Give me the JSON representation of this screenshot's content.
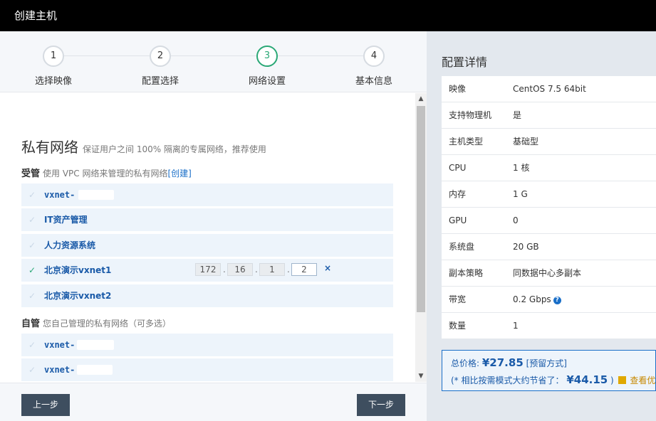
{
  "window": {
    "title": "创建主机"
  },
  "steps": [
    {
      "num": "1",
      "label": "选择映像"
    },
    {
      "num": "2",
      "label": "配置选择"
    },
    {
      "num": "3",
      "label": "网络设置"
    },
    {
      "num": "4",
      "label": "基本信息"
    }
  ],
  "network": {
    "title": "私有网络",
    "subtitle": "保证用户之间 100% 隔离的专属网络，推荐使用",
    "managed": {
      "label": "受管",
      "desc": "使用 VPC 网络来管理的私有网络",
      "create_link": "[创建]",
      "items": [
        {
          "name": "vxnet-"
        },
        {
          "name": "IT资产管理"
        },
        {
          "name": "人力资源系统"
        },
        {
          "name": "北京演示vxnet1"
        },
        {
          "name": "北京演示vxnet2"
        }
      ],
      "ip": [
        "172",
        "16",
        "1",
        "2"
      ],
      "ip_dot": ".",
      "remove": "×"
    },
    "self": {
      "label": "自管",
      "desc": "您自己管理的私有网络（可多选）",
      "items": [
        {
          "name": "vxnet-"
        },
        {
          "name": "vxnet-"
        }
      ]
    }
  },
  "check_glyph": "✓",
  "footer": {
    "prev": "上一步",
    "next": "下一步"
  },
  "details": {
    "title": "配置详情",
    "rows": [
      {
        "k": "映像",
        "v": "CentOS 7.5 64bit"
      },
      {
        "k": "支持物理机",
        "v": "是"
      },
      {
        "k": "主机类型",
        "v": "基础型"
      },
      {
        "k": "CPU",
        "v": "1 核"
      },
      {
        "k": "内存",
        "v": "1 G"
      },
      {
        "k": "GPU",
        "v": "0"
      },
      {
        "k": "系统盘",
        "v": "20 GB"
      },
      {
        "k": "副本策略",
        "v": "同数据中心多副本"
      },
      {
        "k": "带宽",
        "v": "0.2 Gbps"
      },
      {
        "k": "数量",
        "v": "1"
      }
    ],
    "help_glyph": "?"
  },
  "price": {
    "label": "总价格:",
    "amount": "¥27.85",
    "mode": "[预留方式]",
    "save_prefix": "(* 相比按需模式大约节省了：",
    "save_amount": "¥44.15",
    "save_suffix": ")",
    "promo": "查看优惠"
  },
  "colors": {
    "accent": "#2aa876",
    "link": "#1a6fc8",
    "dark": "#3e4e5f"
  }
}
